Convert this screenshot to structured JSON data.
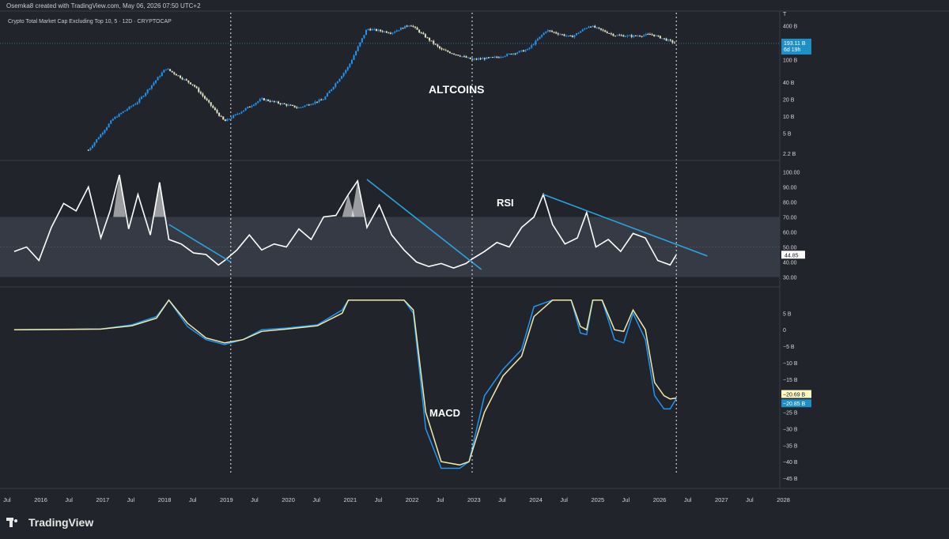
{
  "header": {
    "title": "Osemka8 created with TradingView.com, May 06, 2026 07:50 UTC+2",
    "symbol": "Crypto Total Market Cap Excluding Top 10, 5 · 12D · CRYPTOCAP"
  },
  "footer": {
    "brand": "TradingView"
  },
  "colors": {
    "background": "#22242b",
    "rsi_band": "#363a45",
    "up_candle": "#2196f3",
    "down_candle": "#e8e6c8",
    "trendline": "#29a3e0",
    "macd_line": "#2196f3",
    "signal_line": "#f1eaa8",
    "grid_divider": "#3a3d47"
  },
  "icons": {
    "logo": "tradingview-logo-icon"
  },
  "chart_data": [
    {
      "type": "candlestick",
      "title": "ALTCOINS",
      "yscale": "log",
      "y_ticks": [
        "400 B",
        "193.11 B",
        "100 B",
        "40 B",
        "20 B",
        "10 B",
        "5 B",
        "2.2 B"
      ],
      "last_value_label": "193.11 B",
      "last_value_sublabel": "6d 19h",
      "approx_series": {
        "x": [
          2016.8,
          2017.2,
          2017.6,
          2018.05,
          2018.5,
          2019.0,
          2019.6,
          2020.2,
          2020.6,
          2021.0,
          2021.3,
          2021.7,
          2022.0,
          2022.5,
          2023.0,
          2023.4,
          2023.9,
          2024.2,
          2024.6,
          2024.9,
          2025.3,
          2025.6,
          2025.9,
          2026.3
        ],
        "y_b": [
          2.5,
          9,
          18,
          70,
          35,
          8,
          20,
          14,
          20,
          75,
          350,
          300,
          420,
          150,
          100,
          110,
          150,
          330,
          250,
          400,
          270,
          260,
          280,
          193
        ]
      }
    },
    {
      "type": "line",
      "title": "RSI",
      "y_ticks": [
        "100.00",
        "90.00",
        "80.00",
        "70.00",
        "60.00",
        "50.00",
        "44.85",
        "40.00",
        "30.00"
      ],
      "ylim": [
        30,
        100
      ],
      "band": [
        30,
        70
      ],
      "last_value_label": "44.85",
      "series": {
        "x": [
          2015.6,
          2015.8,
          2016.0,
          2016.2,
          2016.4,
          2016.6,
          2016.8,
          2017.0,
          2017.15,
          2017.3,
          2017.45,
          2017.6,
          2017.8,
          2017.95,
          2018.1,
          2018.3,
          2018.5,
          2018.7,
          2018.9,
          2019.0,
          2019.2,
          2019.4,
          2019.6,
          2019.8,
          2020.0,
          2020.2,
          2020.4,
          2020.6,
          2020.8,
          2021.0,
          2021.15,
          2021.3,
          2021.5,
          2021.7,
          2021.9,
          2022.1,
          2022.3,
          2022.5,
          2022.7,
          2022.9,
          2023.0,
          2023.2,
          2023.4,
          2023.6,
          2023.8,
          2024.0,
          2024.15,
          2024.3,
          2024.5,
          2024.7,
          2024.85,
          2025.0,
          2025.2,
          2025.4,
          2025.6,
          2025.8,
          2026.0,
          2026.2,
          2026.3
        ],
        "values": [
          47,
          50,
          41,
          63,
          79,
          74,
          90,
          56,
          74,
          98,
          62,
          85,
          58,
          93,
          55,
          52,
          46,
          45,
          38,
          41,
          48,
          58,
          48,
          52,
          50,
          62,
          55,
          70,
          71,
          85,
          94,
          63,
          78,
          58,
          48,
          40,
          37,
          39,
          36,
          39,
          42,
          47,
          53,
          50,
          63,
          70,
          85,
          65,
          52,
          56,
          73,
          50,
          55,
          47,
          59,
          56,
          41,
          38,
          44.85
        ]
      },
      "trendlines": [
        {
          "x": [
            2018.1,
            2019.1
          ],
          "y": [
            65,
            40
          ]
        },
        {
          "x": [
            2021.3,
            2023.15
          ],
          "y": [
            95,
            35
          ]
        },
        {
          "x": [
            2024.15,
            2026.8
          ],
          "y": [
            85,
            44
          ]
        }
      ]
    },
    {
      "type": "line",
      "title": "MACD",
      "y_ticks": [
        "5 B",
        "0",
        "−5 B",
        "−10 B",
        "−15 B",
        "−20 B",
        "−25 B",
        "−30 B",
        "−35 B",
        "−40 B",
        "−45 B"
      ],
      "ylim": [
        -45,
        7
      ],
      "last_value_labels": [
        "−20.69 B",
        "−20.85 B"
      ],
      "series": [
        {
          "name": "MACD",
          "x": [
            2015.6,
            2017.0,
            2017.5,
            2017.9,
            2018.1,
            2018.4,
            2018.7,
            2019.0,
            2019.3,
            2019.6,
            2020.0,
            2020.5,
            2020.9,
            2021.0,
            2021.35,
            2021.4,
            2021.6,
            2021.8,
            2021.9,
            2022.05,
            2022.25,
            2022.5,
            2022.8,
            2022.95,
            2023.2,
            2023.5,
            2023.8,
            2024.0,
            2024.3,
            2024.6,
            2024.75,
            2024.85,
            2024.95,
            2025.1,
            2025.3,
            2025.45,
            2025.6,
            2025.8,
            2025.95,
            2026.1,
            2026.2,
            2026.3
          ],
          "values": [
            0,
            0.2,
            1.5,
            4,
            9,
            1,
            -3,
            -4.5,
            -3,
            0,
            0.5,
            1.5,
            6,
            9,
            9,
            9,
            9,
            9,
            9,
            5,
            -30,
            -42,
            -42,
            -40,
            -20,
            -12,
            -6,
            7,
            9,
            9,
            -1,
            -1.5,
            9,
            9,
            -3,
            -4,
            5,
            -3,
            -20,
            -24,
            -24,
            -20.85
          ]
        },
        {
          "name": "Signal",
          "x": [
            2015.6,
            2017.0,
            2017.5,
            2017.9,
            2018.1,
            2018.4,
            2018.7,
            2019.0,
            2019.3,
            2019.6,
            2020.0,
            2020.5,
            2020.9,
            2021.0,
            2021.35,
            2021.4,
            2021.6,
            2021.8,
            2021.9,
            2022.05,
            2022.25,
            2022.5,
            2022.8,
            2022.95,
            2023.2,
            2023.5,
            2023.8,
            2024.0,
            2024.3,
            2024.6,
            2024.75,
            2024.85,
            2024.95,
            2025.1,
            2025.3,
            2025.45,
            2025.6,
            2025.8,
            2025.95,
            2026.1,
            2026.2,
            2026.3
          ],
          "values": [
            0,
            0.2,
            1.2,
            3.5,
            9,
            2,
            -2.5,
            -4,
            -3,
            -0.5,
            0.2,
            1.2,
            5,
            9,
            9,
            9,
            9,
            9,
            9,
            6,
            -25,
            -40,
            -41,
            -40,
            -25,
            -14,
            -8,
            4,
            9,
            9,
            1,
            0,
            9,
            9,
            0,
            -0.5,
            6,
            0,
            -16,
            -20,
            -21,
            -20.69
          ]
        }
      ]
    },
    {
      "type": "axis",
      "x_ticks": [
        "Jul",
        "2016",
        "Jul",
        "2017",
        "Jul",
        "2018",
        "Jul",
        "2019",
        "Jul",
        "2020",
        "Jul",
        "2021",
        "Jul",
        "2022",
        "Jul",
        "2023",
        "Jul",
        "2024",
        "Jul",
        "2025",
        "Jul",
        "2026",
        "Jul",
        "2027",
        "Jul",
        "2028"
      ],
      "x_tick_values": [
        2015.5,
        2016.0,
        2016.5,
        2017.0,
        2017.5,
        2018.0,
        2018.5,
        2019.0,
        2019.5,
        2020.0,
        2020.5,
        2021.0,
        2021.5,
        2022.0,
        2022.5,
        2023.0,
        2023.5,
        2024.0,
        2024.5,
        2025.0,
        2025.5,
        2026.0,
        2026.5,
        2027.0,
        2027.5,
        2028.0
      ],
      "vertical_markers": [
        2019.1,
        2023.0,
        2026.3
      ]
    }
  ]
}
